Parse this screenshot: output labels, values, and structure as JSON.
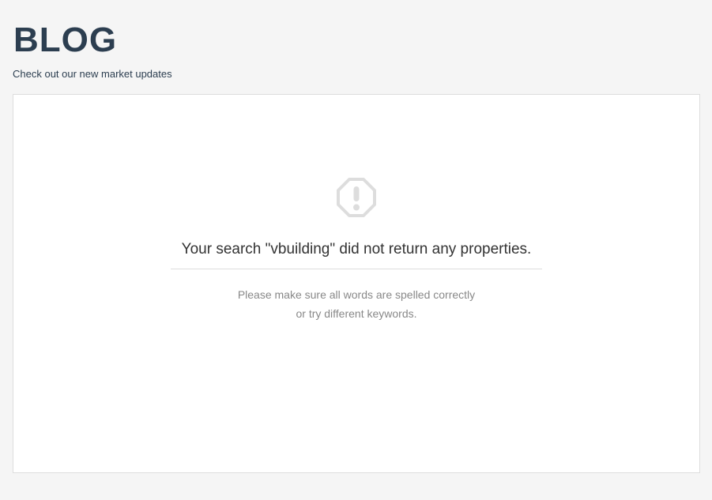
{
  "header": {
    "title": "BLOG",
    "subtitle": "Check out our new market updates"
  },
  "empty_state": {
    "icon": "alert-octagon-icon",
    "message": "Your search \"vbuilding\" did not return any properties.",
    "hint_line1": "Please make sure all words are spelled correctly",
    "hint_line2": "or try different keywords."
  },
  "colors": {
    "page_background": "#f5f5f5",
    "heading": "#2c3e50",
    "panel_background": "#ffffff",
    "panel_border": "#dddddd",
    "icon": "#dddddd",
    "message": "#333333",
    "hint": "#888888"
  }
}
